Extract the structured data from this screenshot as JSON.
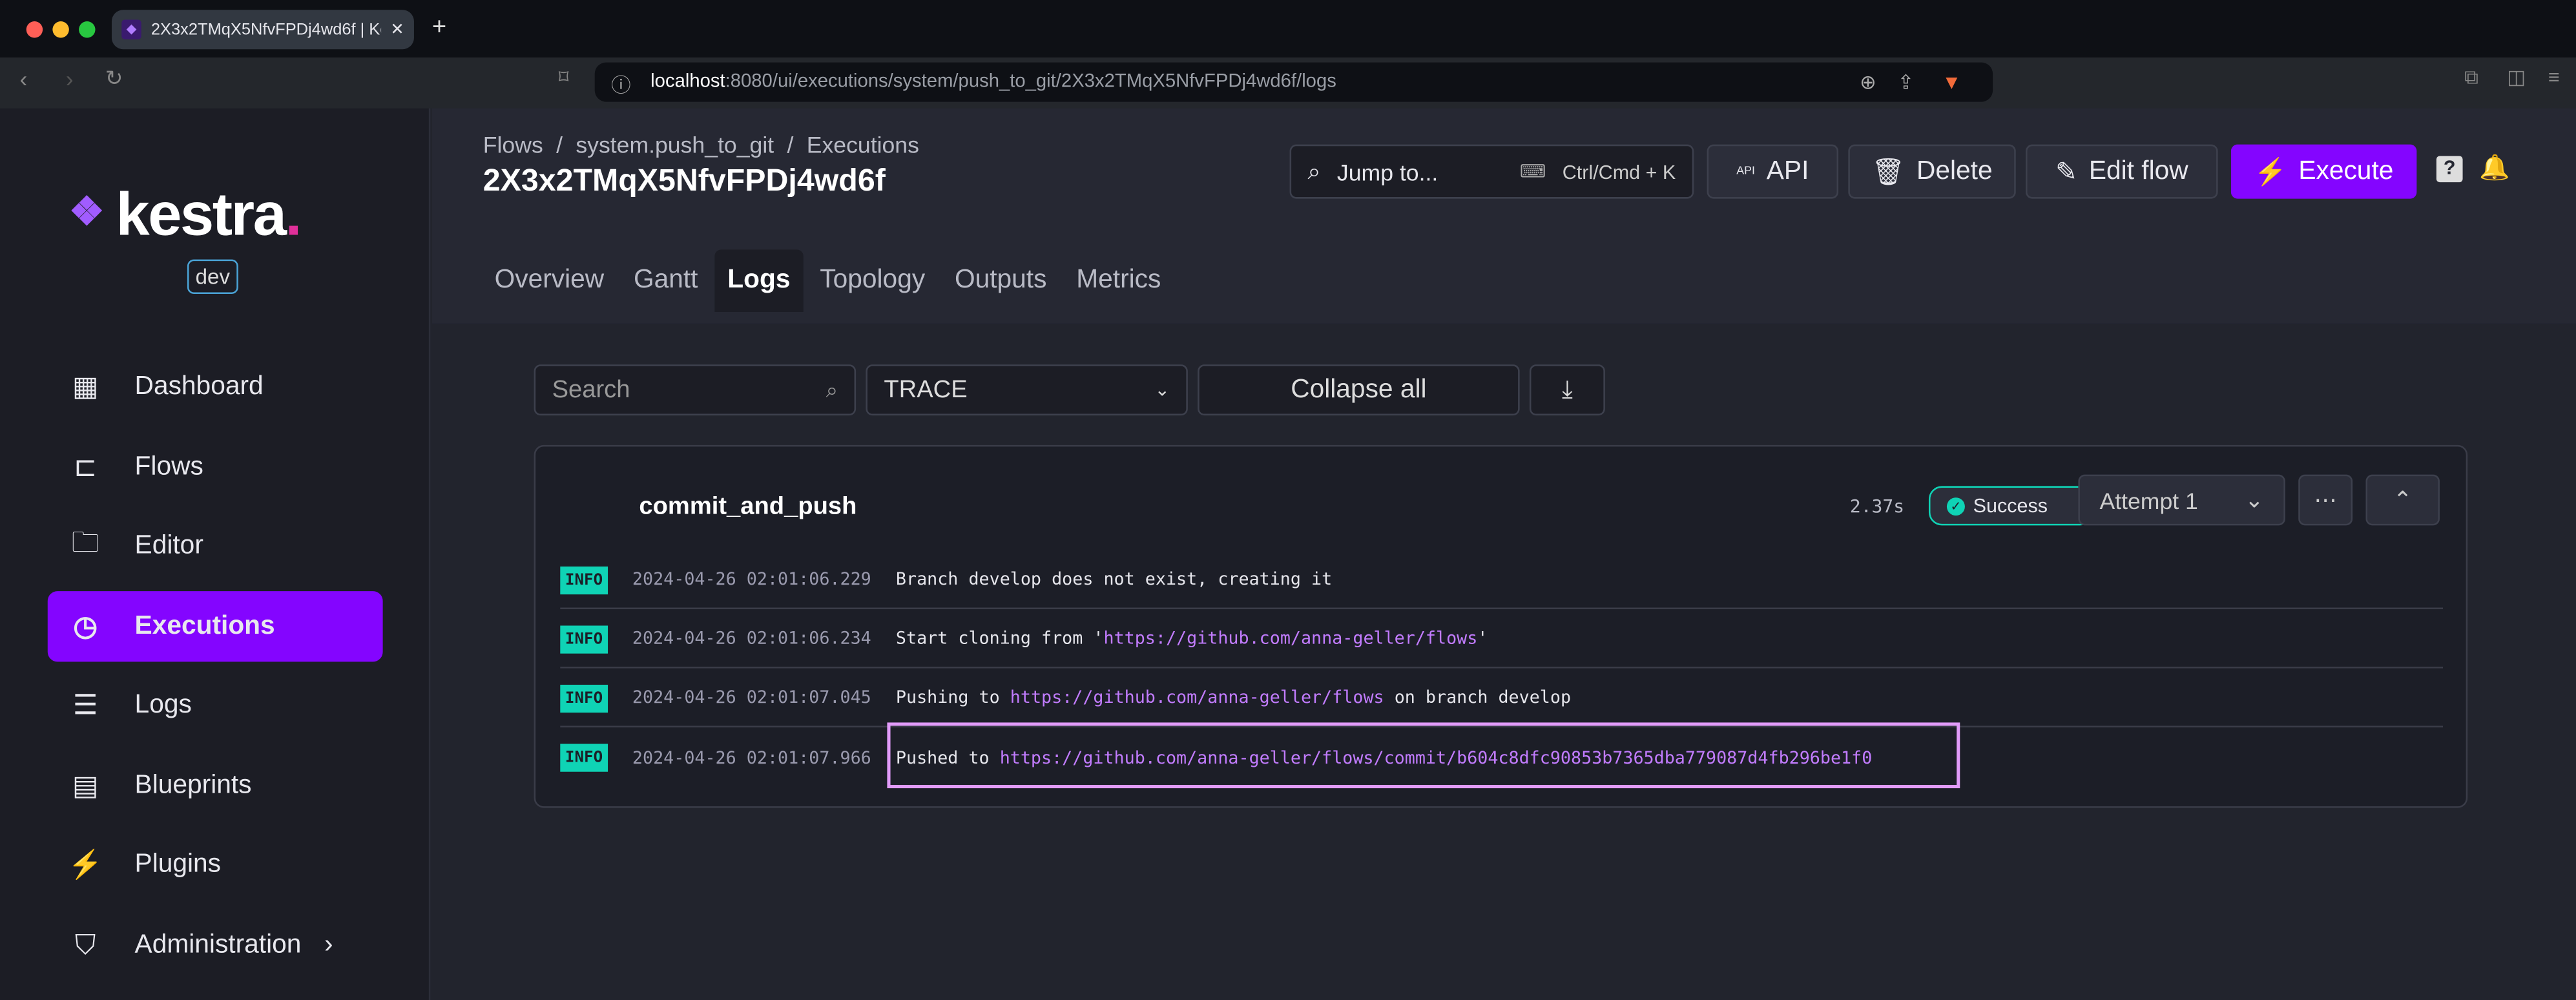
{
  "browser": {
    "tab_title": "2X3x2TMqX5NfvFPDj4wd6f | Kestra",
    "url_host": "localhost",
    "url_rest": ":8080/ui/executions/system/push_to_git/2X3x2TMqX5NfvFPDj4wd6f/logs"
  },
  "sidebar": {
    "logo": "kestra",
    "env": "dev",
    "items": [
      {
        "label": "Dashboard",
        "icon": "dashboard-icon"
      },
      {
        "label": "Flows",
        "icon": "flows-icon"
      },
      {
        "label": "Editor",
        "icon": "folder-icon"
      },
      {
        "label": "Executions",
        "icon": "executions-icon",
        "active": true
      },
      {
        "label": "Logs",
        "icon": "logs-icon"
      },
      {
        "label": "Blueprints",
        "icon": "blueprints-icon"
      },
      {
        "label": "Plugins",
        "icon": "plugin-icon"
      },
      {
        "label": "Administration",
        "icon": "shield-icon"
      }
    ]
  },
  "header": {
    "breadcrumb": [
      "Flows",
      "system.push_to_git",
      "Executions"
    ],
    "title": "2X3x2TMqX5NfvFPDj4wd6f",
    "jump": "Jump to...",
    "jump_shortcut": "Ctrl/Cmd + K",
    "api": "API",
    "delete": "Delete",
    "edit_flow": "Edit flow",
    "execute": "Execute"
  },
  "tabs": [
    "Overview",
    "Gantt",
    "Logs",
    "Topology",
    "Outputs",
    "Metrics"
  ],
  "filters": {
    "search_placeholder": "Search",
    "level": "TRACE",
    "collapse": "Collapse all"
  },
  "task": {
    "name": "commit_and_push",
    "duration": "2.37s",
    "status": "Success",
    "attempt": "Attempt 1"
  },
  "logs": [
    {
      "level": "INFO",
      "time": "2024-04-26 02:01:06.229",
      "pre": "Branch develop does not exist, creating it",
      "link": "",
      "post": ""
    },
    {
      "level": "INFO",
      "time": "2024-04-26 02:01:06.234",
      "pre": "Start cloning from '",
      "link": "https://github.com/anna-geller/flows",
      "post": "'"
    },
    {
      "level": "INFO",
      "time": "2024-04-26 02:01:07.045",
      "pre": "Pushing to ",
      "link": "https://github.com/anna-geller/flows",
      "post": " on branch develop"
    },
    {
      "level": "INFO",
      "time": "2024-04-26 02:01:07.966",
      "pre": "Pushed to ",
      "link": "https://github.com/anna-geller/flows/commit/b604c8dfc90853b7365dba779087d4fb296be1f0",
      "post": ""
    }
  ],
  "colors": {
    "accent": "#8405ff",
    "success": "#0fd3b5",
    "link": "#c27cff",
    "highlight": "#e19bf9"
  }
}
